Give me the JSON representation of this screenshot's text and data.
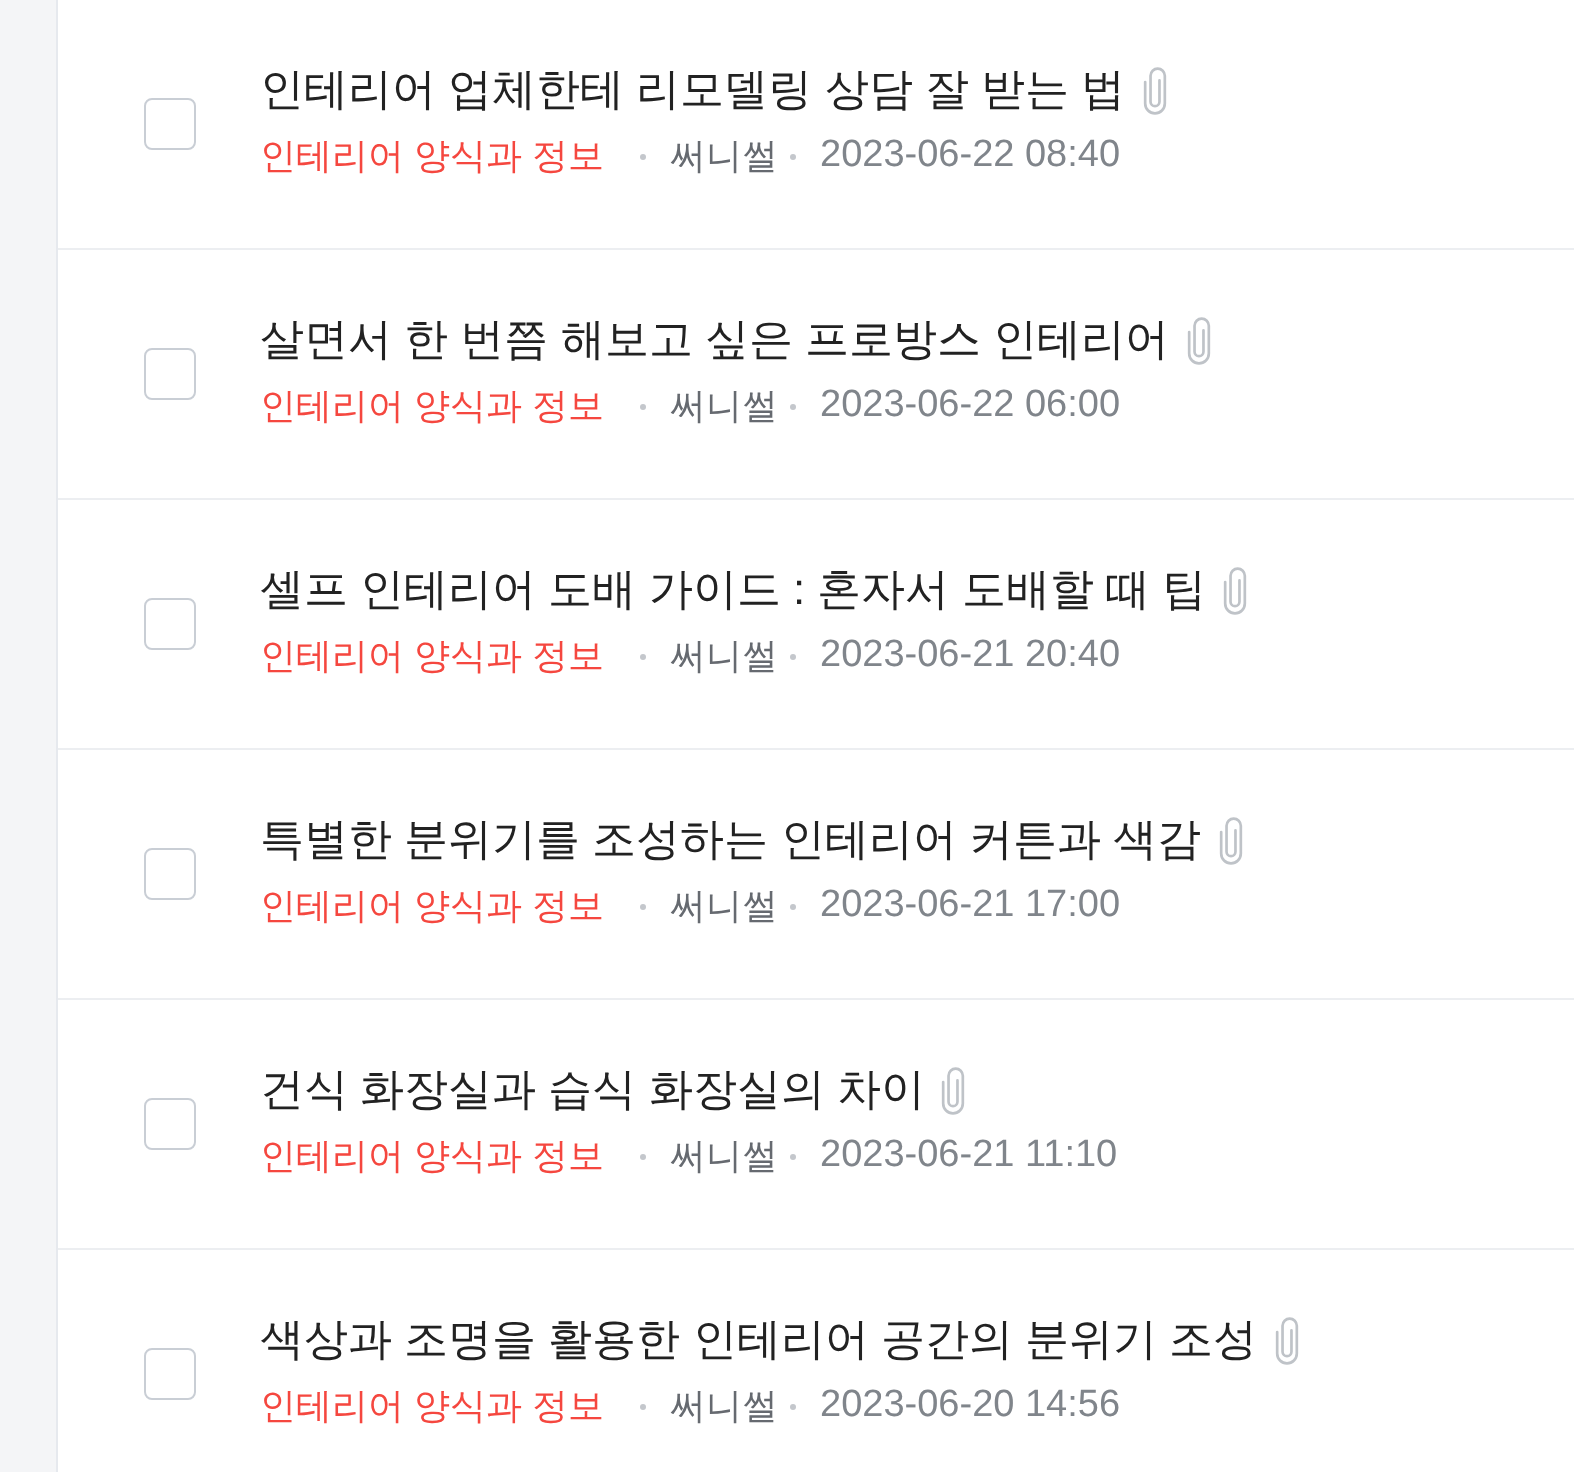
{
  "posts": [
    {
      "title": "인테리어 업체한테 리모델링 상담 잘 받는 법",
      "has_attachment": true,
      "checked": false,
      "category": "인테리어 양식과 정보",
      "author": "써니썰",
      "date": "2023-06-22 08:40"
    },
    {
      "title": "살면서 한 번쯤 해보고 싶은 프로방스 인테리어",
      "has_attachment": true,
      "checked": false,
      "category": "인테리어 양식과 정보",
      "author": "써니썰",
      "date": "2023-06-22 06:00"
    },
    {
      "title": "셀프 인테리어 도배 가이드 : 혼자서 도배할 때 팁",
      "has_attachment": true,
      "checked": false,
      "category": "인테리어 양식과 정보",
      "author": "써니썰",
      "date": "2023-06-21 20:40"
    },
    {
      "title": "특별한 분위기를 조성하는 인테리어 커튼과 색감",
      "has_attachment": true,
      "checked": false,
      "category": "인테리어 양식과 정보",
      "author": "써니썰",
      "date": "2023-06-21 17:00"
    },
    {
      "title": "건식 화장실과 습식 화장실의 차이",
      "has_attachment": true,
      "checked": false,
      "category": "인테리어 양식과 정보",
      "author": "써니썰",
      "date": "2023-06-21 11:10"
    },
    {
      "title": "색상과 조명을 활용한 인테리어 공간의 분위기 조성",
      "has_attachment": true,
      "checked": false,
      "category": "인테리어 양식과 정보",
      "author": "써니썰",
      "date": "2023-06-20 14:56"
    }
  ]
}
